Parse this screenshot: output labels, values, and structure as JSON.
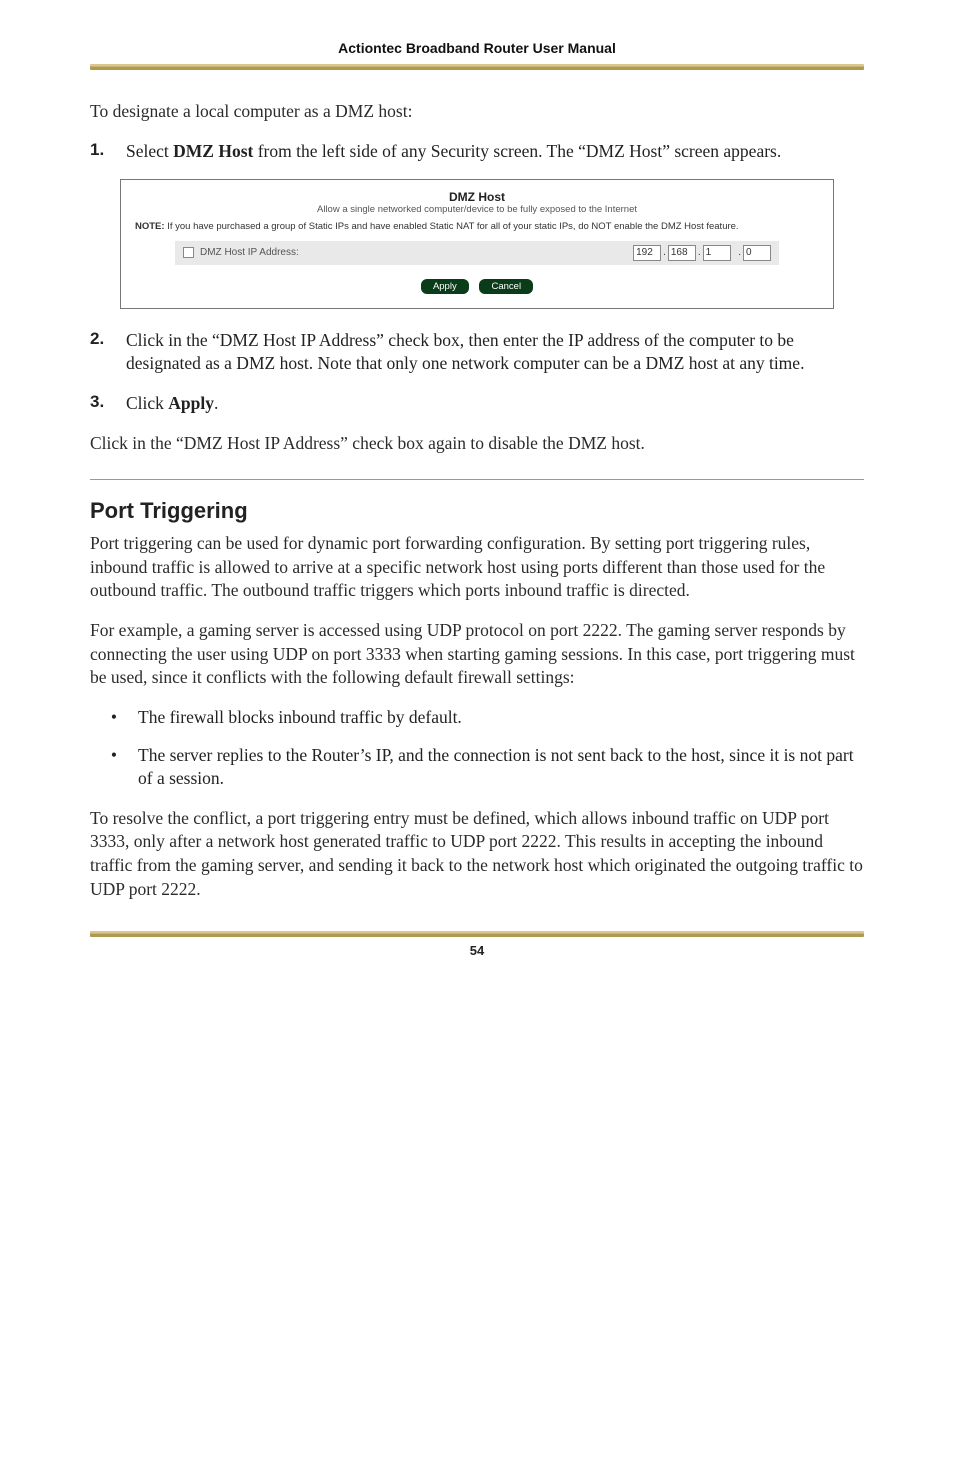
{
  "header": {
    "title": "Actiontec Broadband Router User Manual"
  },
  "intro": "To designate a local computer as a DMZ host:",
  "steps": [
    {
      "num": "1.",
      "pre": "Select ",
      "bold": "DMZ Host",
      "post": " from the left side of any Security screen. The “DMZ Host” screen appears."
    },
    {
      "num": "2.",
      "text": "Click in the “DMZ Host IP Address” check box, then enter the IP address of the computer to be designated as a DMZ host. Note that only one network computer can be a DMZ host at any time."
    },
    {
      "num": "3.",
      "pre": "Click ",
      "bold": "Apply",
      "post": "."
    }
  ],
  "screenshot": {
    "title": "DMZ Host",
    "subtitle": "Allow a single networked computer/device to be fully exposed to the Internet",
    "note_bold": "NOTE:",
    "note_rest": " If you have purchased a group of Static IPs and have enabled Static NAT for all of your static IPs, do NOT enable the DMZ Host feature.",
    "row_label": "DMZ Host IP Address:",
    "ip": [
      "192",
      "168",
      "1",
      "0"
    ],
    "apply": "Apply",
    "cancel": "Cancel"
  },
  "after_steps": "Click in the “DMZ Host IP Address” check box again to disable the DMZ host.",
  "section": {
    "heading": "Port Triggering",
    "p1": "Port triggering can be used for dynamic port forwarding configuration. By setting port triggering rules, inbound traffic is allowed to arrive at a specific network host using ports different than those used for the outbound traffic. The outbound traffic triggers which ports inbound traffic is directed.",
    "p2": "For example, a gaming server is accessed using UDP protocol on port 2222. The gaming server responds by connecting the user using UDP on port 3333 when starting gaming sessions. In this case, port triggering must be used, since it conflicts with the following default firewall settings:",
    "bullets": [
      "The firewall blocks inbound traffic by default.",
      "The server replies to the Router’s IP, and the connection is not sent back to the host, since it is not part of a session."
    ],
    "p3": "To resolve the conflict, a port triggering entry must be defined, which allows inbound traffic on UDP port 3333, only after a network host generated traffic to UDP port 2222. This results in accepting the inbound traffic from the gaming server, and sending it back to the network host which originated the outgoing traffic to UDP port 2222."
  },
  "footer": {
    "page": "54"
  }
}
